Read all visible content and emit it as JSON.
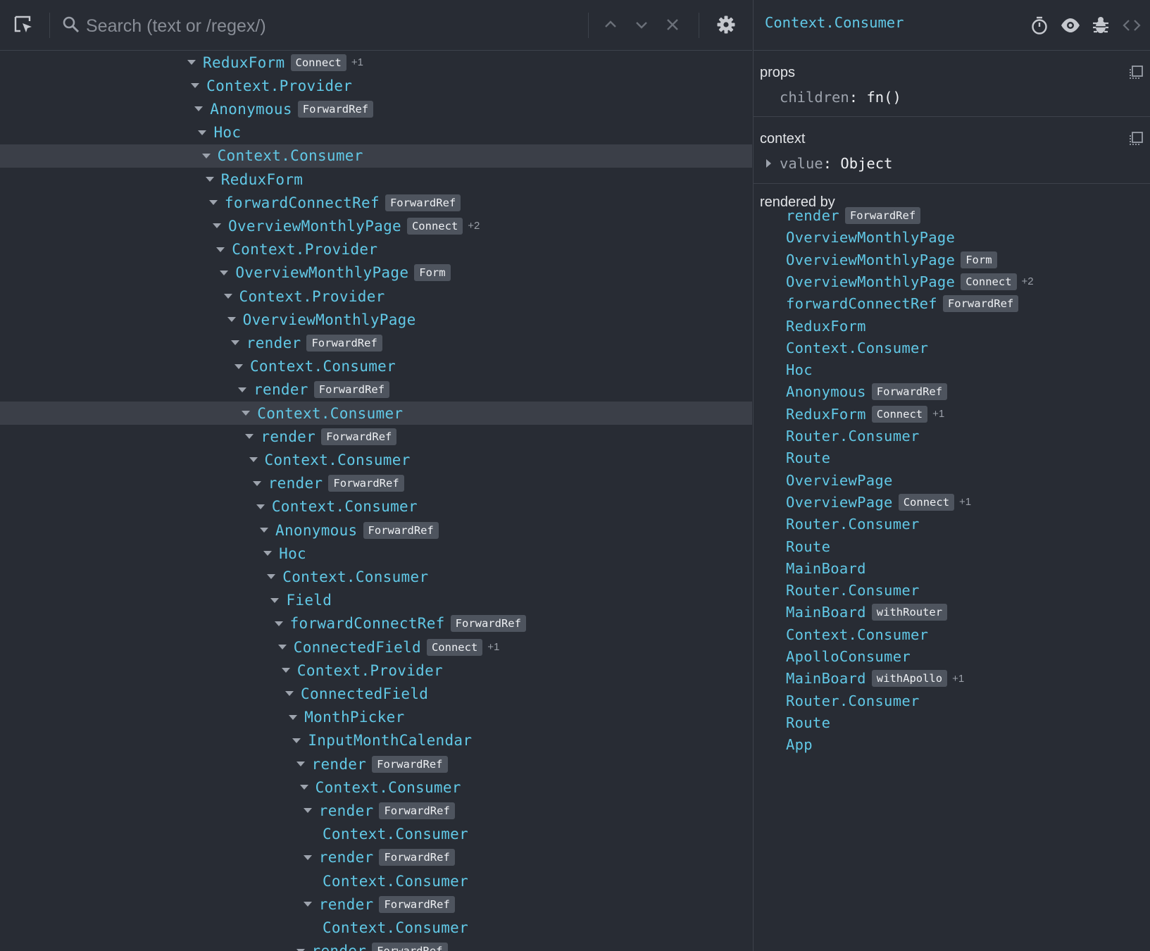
{
  "toolbar": {
    "search_placeholder": "Search (text or /regex/)",
    "icons": [
      "select-element-icon",
      "search-icon",
      "previous-result-icon",
      "next-result-icon",
      "clear-search-icon",
      "settings-icon"
    ]
  },
  "tree": [
    {
      "name": "ReduxForm",
      "depth": 0,
      "badge": "Connect",
      "extra": "+1",
      "expanded": true
    },
    {
      "name": "Context.Provider",
      "depth": 1,
      "expanded": true
    },
    {
      "name": "Anonymous",
      "depth": 2,
      "badge": "ForwardRef",
      "expanded": true
    },
    {
      "name": "Hoc",
      "depth": 3,
      "expanded": true
    },
    {
      "name": "Context.Consumer",
      "depth": 4,
      "expanded": true,
      "selected": true
    },
    {
      "name": "ReduxForm",
      "depth": 5,
      "expanded": true
    },
    {
      "name": "forwardConnectRef",
      "depth": 6,
      "badge": "ForwardRef",
      "expanded": true
    },
    {
      "name": "OverviewMonthlyPage",
      "depth": 7,
      "badge": "Connect",
      "extra": "+2",
      "expanded": true
    },
    {
      "name": "Context.Provider",
      "depth": 8,
      "expanded": true
    },
    {
      "name": "OverviewMonthlyPage",
      "depth": 9,
      "badge": "Form",
      "expanded": true
    },
    {
      "name": "Context.Provider",
      "depth": 10,
      "expanded": true
    },
    {
      "name": "OverviewMonthlyPage",
      "depth": 11,
      "expanded": true
    },
    {
      "name": "render",
      "depth": 12,
      "badge": "ForwardRef",
      "expanded": true
    },
    {
      "name": "Context.Consumer",
      "depth": 13,
      "expanded": true
    },
    {
      "name": "render",
      "depth": 14,
      "badge": "ForwardRef",
      "expanded": true
    },
    {
      "name": "Context.Consumer",
      "depth": 15,
      "expanded": true,
      "selected": true
    },
    {
      "name": "render",
      "depth": 16,
      "badge": "ForwardRef",
      "expanded": true
    },
    {
      "name": "Context.Consumer",
      "depth": 17,
      "expanded": true
    },
    {
      "name": "render",
      "depth": 18,
      "badge": "ForwardRef",
      "expanded": true
    },
    {
      "name": "Context.Consumer",
      "depth": 19,
      "expanded": true
    },
    {
      "name": "Anonymous",
      "depth": 20,
      "badge": "ForwardRef",
      "expanded": true
    },
    {
      "name": "Hoc",
      "depth": 21,
      "expanded": true
    },
    {
      "name": "Context.Consumer",
      "depth": 22,
      "expanded": true
    },
    {
      "name": "Field",
      "depth": 23,
      "expanded": true
    },
    {
      "name": "forwardConnectRef",
      "depth": 24,
      "badge": "ForwardRef",
      "expanded": true
    },
    {
      "name": "ConnectedField",
      "depth": 25,
      "badge": "Connect",
      "extra": "+1",
      "expanded": true
    },
    {
      "name": "Context.Provider",
      "depth": 26,
      "expanded": true
    },
    {
      "name": "ConnectedField",
      "depth": 27,
      "expanded": true
    },
    {
      "name": "MonthPicker",
      "depth": 28,
      "expanded": true
    },
    {
      "name": "InputMonthCalendar",
      "depth": 29,
      "expanded": true
    },
    {
      "name": "render",
      "depth": 30,
      "badge": "ForwardRef",
      "expanded": true
    },
    {
      "name": "Context.Consumer",
      "depth": 31,
      "expanded": true
    },
    {
      "name": "render",
      "depth": 32,
      "badge": "ForwardRef",
      "expanded": true
    },
    {
      "name": "Context.Consumer",
      "depth": 33,
      "expanded": false
    },
    {
      "name": "render",
      "depth": 32,
      "badge": "ForwardRef",
      "expanded": true
    },
    {
      "name": "Context.Consumer",
      "depth": 33,
      "expanded": false
    },
    {
      "name": "render",
      "depth": 32,
      "badge": "ForwardRef",
      "expanded": true
    },
    {
      "name": "Context.Consumer",
      "depth": 33,
      "expanded": false
    },
    {
      "name": "render",
      "depth": 30,
      "badge": "ForwardRef",
      "expanded": true
    }
  ],
  "inspector": {
    "title": "Context.Consumer",
    "icons": [
      "suspend-icon",
      "inspect-dom-icon",
      "log-data-icon",
      "view-source-icon"
    ],
    "props": {
      "title": "props",
      "items": [
        {
          "key": "children",
          "value": "fn()"
        }
      ]
    },
    "context": {
      "title": "context",
      "items": [
        {
          "key": "value",
          "value": "Object",
          "expandable": true
        }
      ]
    },
    "rendered_by": {
      "title": "rendered by",
      "items": [
        {
          "name": "render",
          "badge": "ForwardRef"
        },
        {
          "name": "OverviewMonthlyPage"
        },
        {
          "name": "OverviewMonthlyPage",
          "badge": "Form"
        },
        {
          "name": "OverviewMonthlyPage",
          "badge": "Connect",
          "extra": "+2"
        },
        {
          "name": "forwardConnectRef",
          "badge": "ForwardRef"
        },
        {
          "name": "ReduxForm"
        },
        {
          "name": "Context.Consumer"
        },
        {
          "name": "Hoc"
        },
        {
          "name": "Anonymous",
          "badge": "ForwardRef"
        },
        {
          "name": "ReduxForm",
          "badge": "Connect",
          "extra": "+1"
        },
        {
          "name": "Router.Consumer"
        },
        {
          "name": "Route"
        },
        {
          "name": "OverviewPage"
        },
        {
          "name": "OverviewPage",
          "badge": "Connect",
          "extra": "+1"
        },
        {
          "name": "Router.Consumer"
        },
        {
          "name": "Route"
        },
        {
          "name": "MainBoard"
        },
        {
          "name": "Router.Consumer"
        },
        {
          "name": "MainBoard",
          "badge": "withRouter"
        },
        {
          "name": "Context.Consumer"
        },
        {
          "name": "ApolloConsumer"
        },
        {
          "name": "MainBoard",
          "badge": "withApollo",
          "extra": "+1"
        },
        {
          "name": "Router.Consumer"
        },
        {
          "name": "Route"
        },
        {
          "name": "App"
        }
      ]
    }
  },
  "colors": {
    "background": "#282c34",
    "accent": "#61c8e6",
    "badge_bg": "#4e545e",
    "selected_row": "#3b3f48",
    "divider": "#3d424b"
  }
}
